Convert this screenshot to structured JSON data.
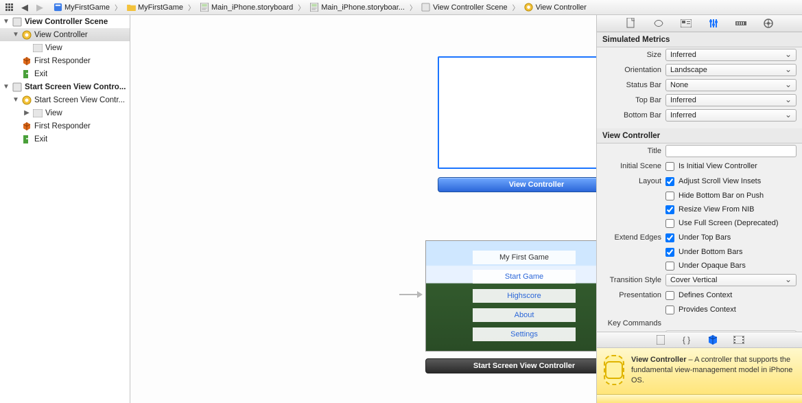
{
  "jumpbar": {
    "crumbs": [
      {
        "icon": "project-icon",
        "label": "MyFirstGame"
      },
      {
        "icon": "folder-icon",
        "label": "MyFirstGame"
      },
      {
        "icon": "storyboard-icon",
        "label": "Main_iPhone.storyboard"
      },
      {
        "icon": "storyboard-icon",
        "label": "Main_iPhone.storyboar..."
      },
      {
        "icon": "scene-icon",
        "label": "View Controller Scene"
      },
      {
        "icon": "viewcontroller-icon",
        "label": "View Controller"
      }
    ]
  },
  "outline": {
    "rows": [
      {
        "indent": 0,
        "disc": "▼",
        "icon": "scene-icon",
        "label": "View Controller Scene",
        "bold": true
      },
      {
        "indent": 1,
        "disc": "▼",
        "icon": "viewcontroller-icon",
        "label": "View Controller",
        "sel": true
      },
      {
        "indent": 2,
        "disc": "",
        "icon": "view-icon",
        "label": "View"
      },
      {
        "indent": 1,
        "disc": "",
        "icon": "firstresponder-icon",
        "label": "First Responder"
      },
      {
        "indent": 1,
        "disc": "",
        "icon": "exit-icon",
        "label": "Exit"
      },
      {
        "indent": 0,
        "disc": "▼",
        "icon": "scene-icon",
        "label": "Start Screen View Contro...",
        "bold": true
      },
      {
        "indent": 1,
        "disc": "▼",
        "icon": "viewcontroller-icon",
        "label": "Start Screen View Contr..."
      },
      {
        "indent": 2,
        "disc": "▶",
        "icon": "view-icon",
        "label": "View"
      },
      {
        "indent": 1,
        "disc": "",
        "icon": "firstresponder-icon",
        "label": "First Responder"
      },
      {
        "indent": 1,
        "disc": "",
        "icon": "exit-icon",
        "label": "Exit"
      }
    ]
  },
  "canvas": {
    "scene1_bar": "View Controller",
    "scene2_bar": "Start Screen View Controller",
    "menu": {
      "title": "My First Game",
      "items": [
        "Start Game",
        "Highscore",
        "About",
        "Settings"
      ]
    }
  },
  "inspector": {
    "simulated_metrics": {
      "heading": "Simulated Metrics",
      "size_label": "Size",
      "size_value": "Inferred",
      "orientation_label": "Orientation",
      "orientation_value": "Landscape",
      "status_label": "Status Bar",
      "status_value": "None",
      "top_label": "Top Bar",
      "top_value": "Inferred",
      "bottom_label": "Bottom Bar",
      "bottom_value": "Inferred"
    },
    "vc": {
      "heading": "View Controller",
      "title_label": "Title",
      "title_value": "",
      "initial_label": "Initial Scene",
      "initial_txt": "Is Initial View Controller",
      "initial_checked": false,
      "layout_label": "Layout",
      "layout_opts": [
        {
          "txt": "Adjust Scroll View Insets",
          "checked": true
        },
        {
          "txt": "Hide Bottom Bar on Push",
          "checked": false
        },
        {
          "txt": "Resize View From NIB",
          "checked": true
        },
        {
          "txt": "Use Full Screen (Deprecated)",
          "checked": false
        }
      ],
      "edges_label": "Extend Edges",
      "edges_opts": [
        {
          "txt": "Under Top Bars",
          "checked": true
        },
        {
          "txt": "Under Bottom Bars",
          "checked": true
        },
        {
          "txt": "Under Opaque Bars",
          "checked": false
        }
      ],
      "trans_label": "Transition Style",
      "trans_value": "Cover Vertical",
      "pres_label": "Presentation",
      "pres_opts": [
        {
          "txt": "Defines Context",
          "checked": false
        },
        {
          "txt": "Provides Context",
          "checked": false
        }
      ],
      "keycmd_label": "Key Commands"
    },
    "library": {
      "item_title": "View Controller",
      "item_desc": " – A controller that supports the fundamental view-management model in iPhone OS."
    }
  }
}
